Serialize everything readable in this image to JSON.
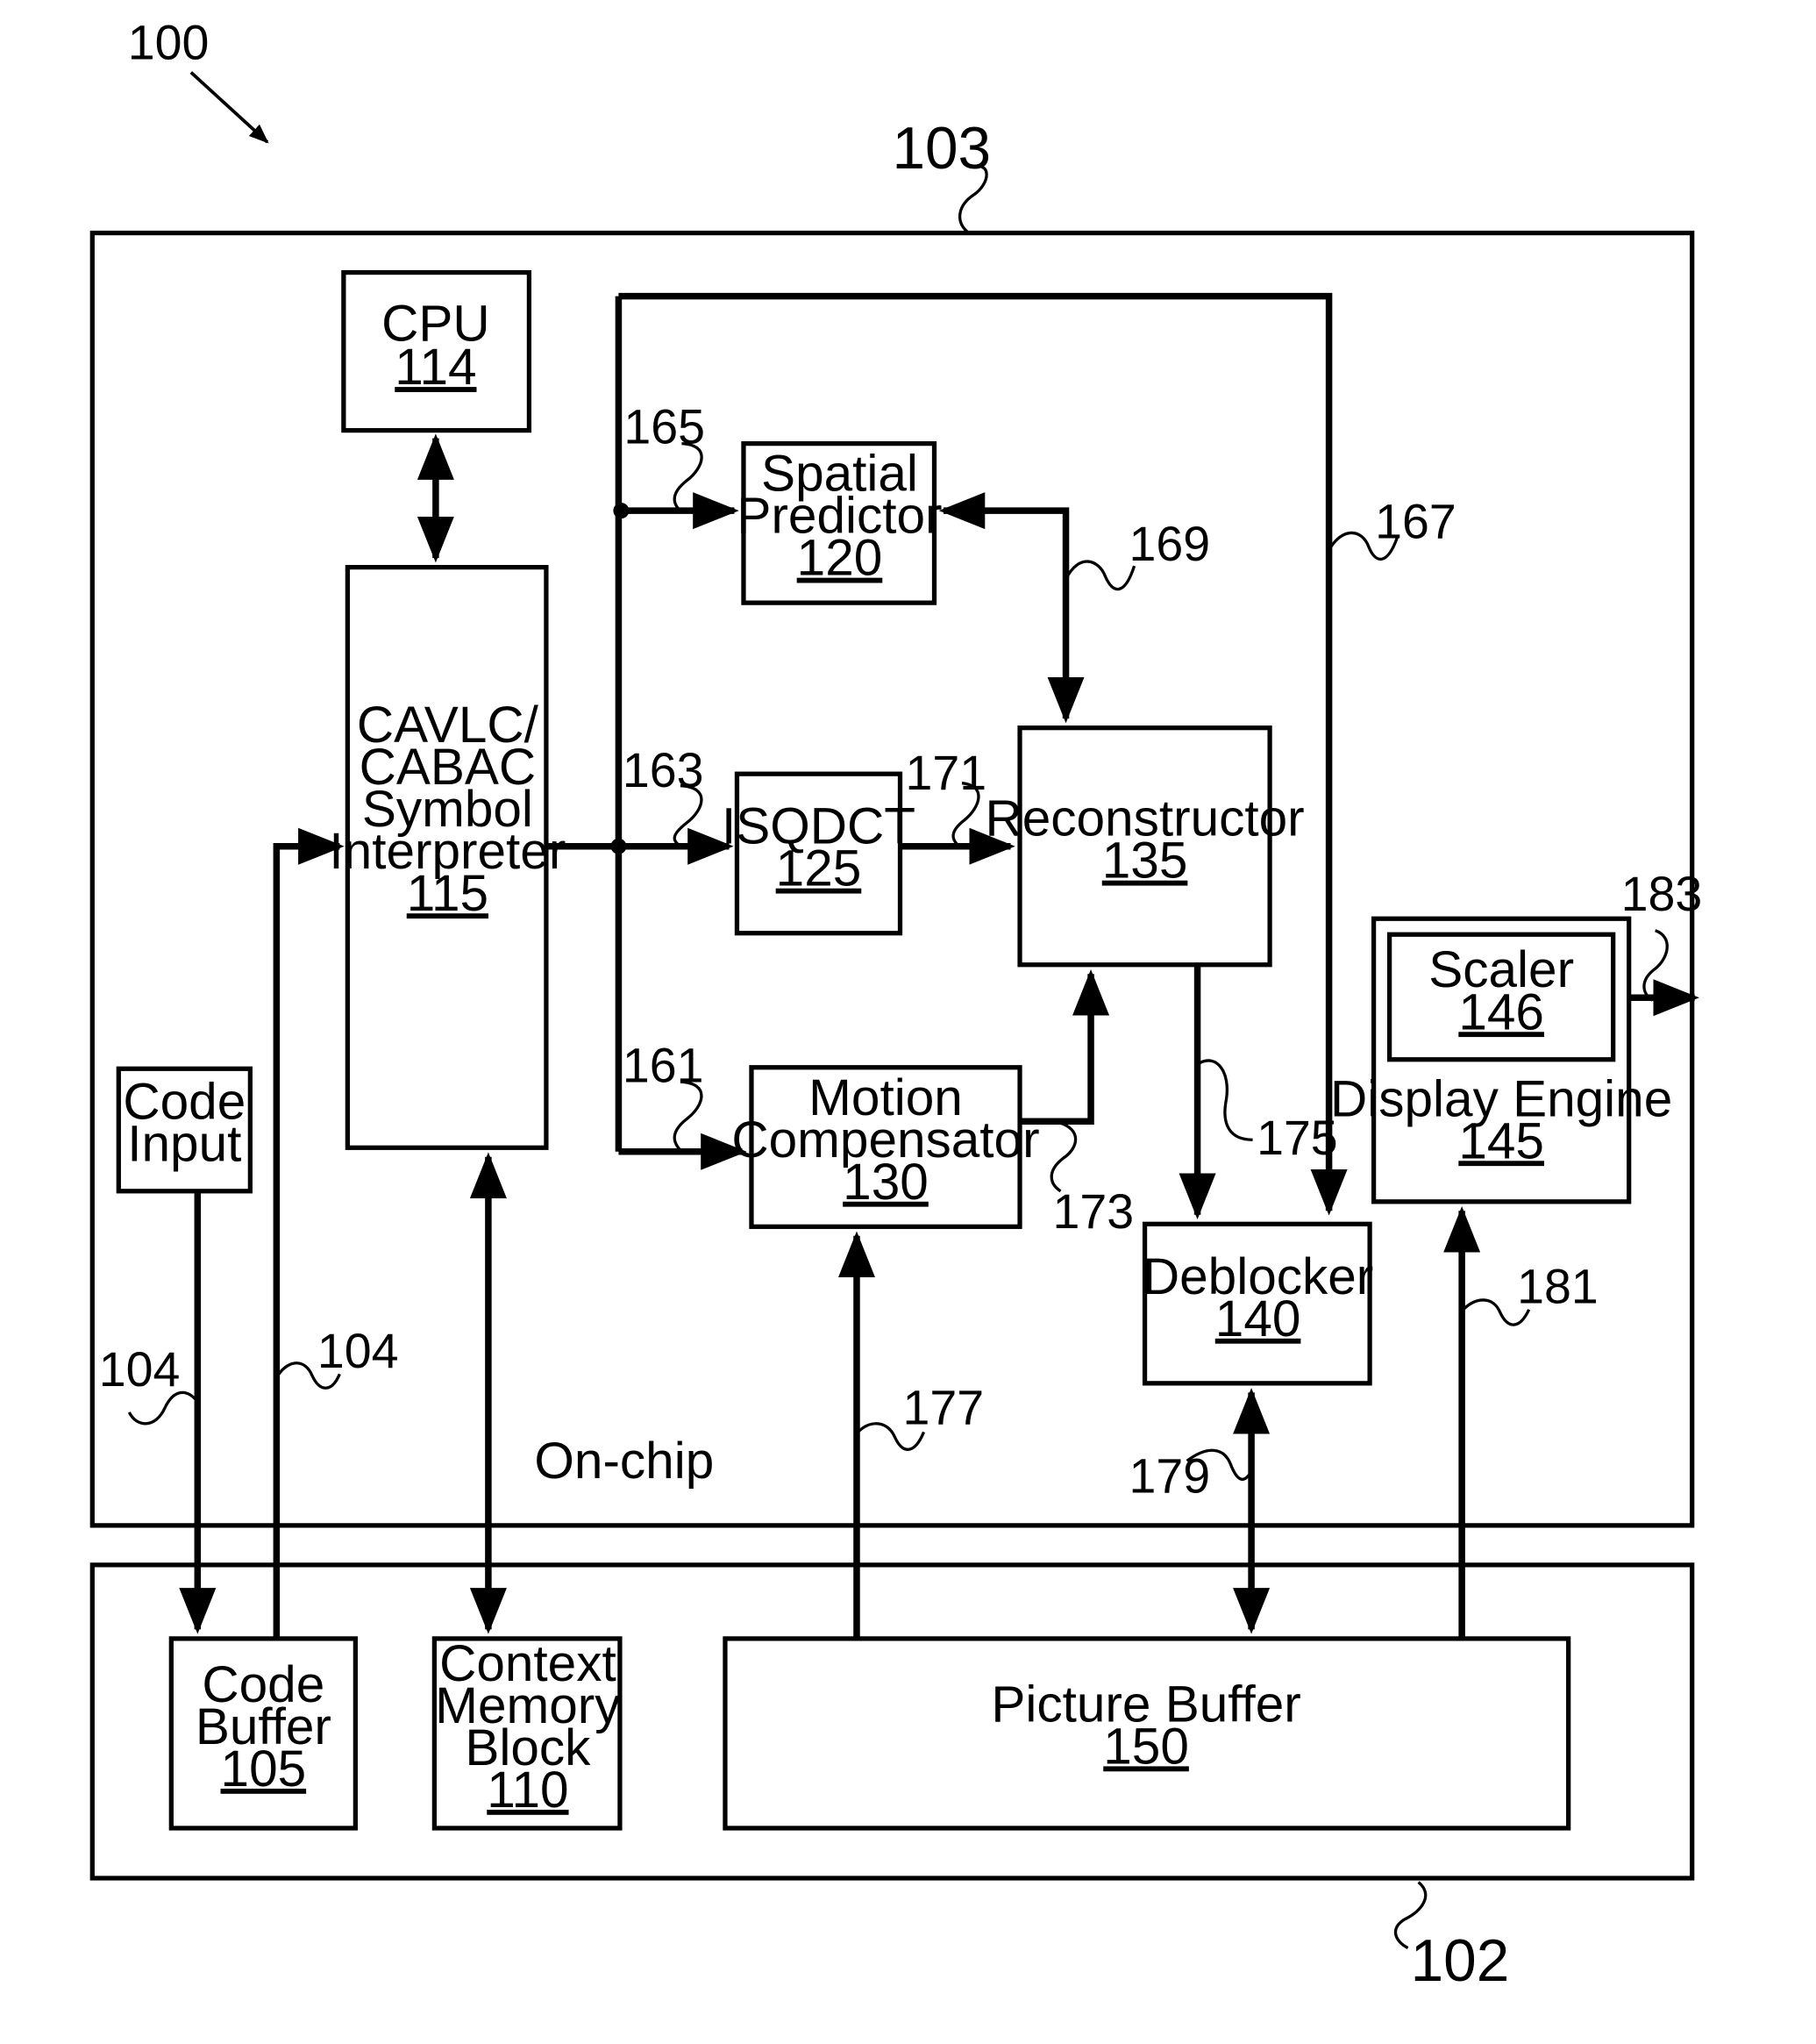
{
  "figure": {
    "ref": "100",
    "on_chip_ref": "103",
    "off_chip_ref": "102",
    "region_label": "On-chip"
  },
  "blocks": {
    "cpu": {
      "name": "CPU",
      "ref": "114"
    },
    "interpreter": {
      "lines": [
        "CAVLC/",
        "CABAC",
        "Symbol",
        "Interpreter"
      ],
      "ref": "115"
    },
    "spatial_predictor": {
      "lines": [
        "Spatial",
        "Predictor"
      ],
      "ref": "120"
    },
    "isqdct": {
      "name": "ISQDCT",
      "ref": "125"
    },
    "reconstructor": {
      "name": "Reconstructor",
      "ref": "135"
    },
    "motion_compensator": {
      "lines": [
        "Motion",
        "Compensator"
      ],
      "ref": "130"
    },
    "deblocker": {
      "name": "Deblocker",
      "ref": "140"
    },
    "display_engine": {
      "name": "Display Engine",
      "ref": "145"
    },
    "scaler": {
      "name": "Scaler",
      "ref": "146"
    },
    "code_input": {
      "lines": [
        "Code",
        "Input"
      ]
    },
    "code_buffer": {
      "lines": [
        "Code",
        "Buffer"
      ],
      "ref": "105"
    },
    "context_memory": {
      "lines": [
        "Context",
        "Memory",
        "Block"
      ],
      "ref": "110"
    },
    "picture_buffer": {
      "name": "Picture Buffer",
      "ref": "150"
    }
  },
  "connections": {
    "c104a": "104",
    "c104b": "104",
    "c161": "161",
    "c163": "163",
    "c165": "165",
    "c167": "167",
    "c169": "169",
    "c171": "171",
    "c173": "173",
    "c175": "175",
    "c177": "177",
    "c179": "179",
    "c181": "181",
    "c183": "183"
  }
}
